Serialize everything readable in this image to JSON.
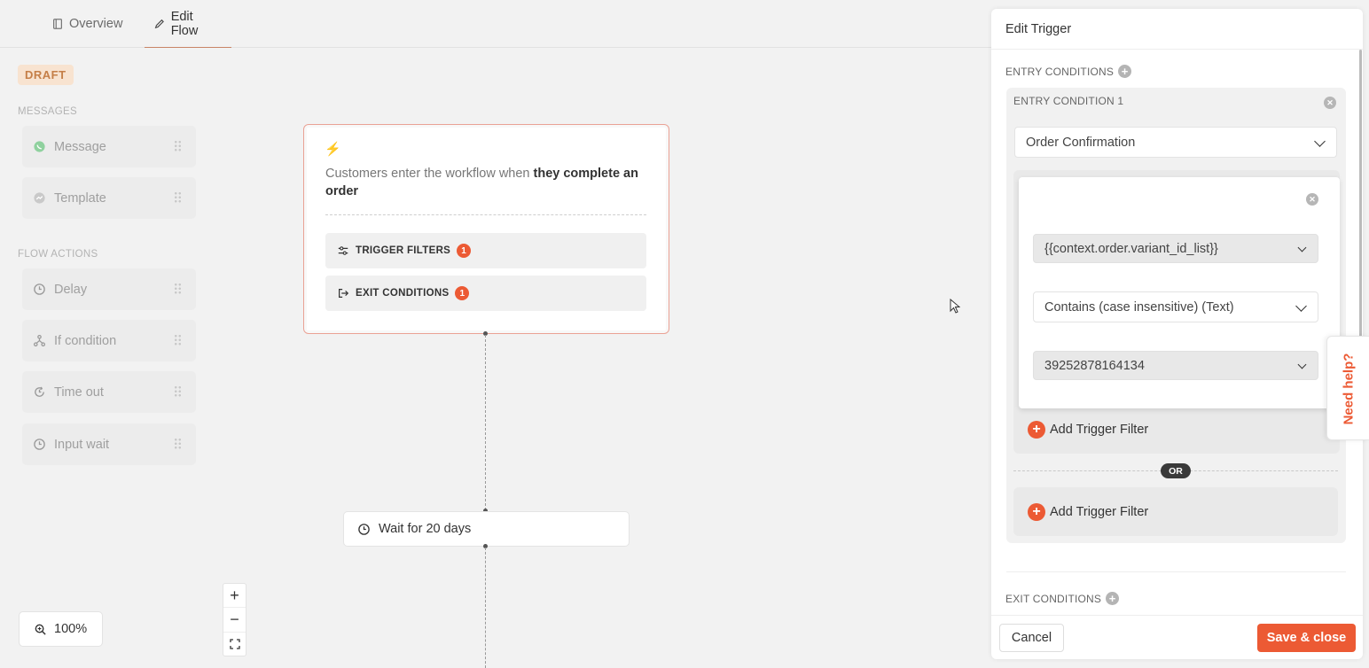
{
  "tabs": [
    {
      "label": "Overview",
      "icon": "book-icon"
    },
    {
      "label": "Edit Flow",
      "icon": "pencil-icon"
    }
  ],
  "status_badge": "DRAFT",
  "palette": {
    "messages_label": "MESSAGES",
    "messages": [
      {
        "label": "Message",
        "icon": "whatsapp-icon"
      },
      {
        "label": "Template",
        "icon": "messenger-icon"
      }
    ],
    "flow_actions_label": "FLOW ACTIONS",
    "flow_actions": [
      {
        "label": "Delay",
        "icon": "clock-icon"
      },
      {
        "label": "If condition",
        "icon": "branch-icon"
      },
      {
        "label": "Time out",
        "icon": "timeout-icon"
      },
      {
        "label": "Input wait",
        "icon": "clock-icon"
      }
    ]
  },
  "trigger_node": {
    "desc_prefix": "Customers enter the workflow when ",
    "desc_bold": "they complete an order",
    "trigger_filters_label": "TRIGGER FILTERS",
    "trigger_filters_count": "1",
    "exit_conditions_label": "EXIT CONDITIONS",
    "exit_conditions_count": "1"
  },
  "wait_node": {
    "label": "Wait for 20 days"
  },
  "zoom": {
    "level": "100%",
    "in": "+",
    "out": "−"
  },
  "panel": {
    "title": "Edit Trigger",
    "entry_conditions_label": "ENTRY CONDITIONS",
    "entry_condition_1_label": "ENTRY CONDITION 1",
    "event_select": "Order Confirmation",
    "filter": {
      "field": "{{context.order.variant_id_list}}",
      "operator": "Contains (case insensitive) (Text)",
      "value": "39252878164134"
    },
    "add_trigger_filter": "Add Trigger Filter",
    "or_label": "OR",
    "exit_conditions_label": "EXIT CONDITIONS",
    "cancel": "Cancel",
    "save": "Save & close"
  },
  "help_tab": "Need help?",
  "colors": {
    "accent": "#ec5a34",
    "draft_bg": "#f8e3d0",
    "draft_text": "#c57f48"
  }
}
